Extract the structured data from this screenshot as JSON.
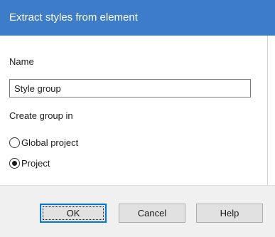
{
  "dialog": {
    "title": "Extract styles from element"
  },
  "name": {
    "label": "Name",
    "value": "Style group"
  },
  "create_group": {
    "label": "Create group in",
    "options": [
      {
        "label": "Global project",
        "selected": false
      },
      {
        "label": "Project",
        "selected": true
      }
    ]
  },
  "buttons": {
    "ok": "OK",
    "cancel": "Cancel",
    "help": "Help"
  },
  "colors": {
    "titlebar": "#3d7cc9",
    "footer": "#f0f0f0",
    "default_button_border": "#0078d7"
  }
}
